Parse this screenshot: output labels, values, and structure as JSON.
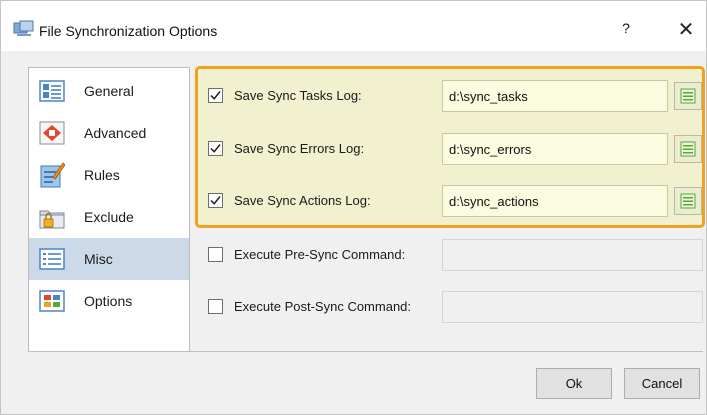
{
  "window": {
    "title": "File Synchronization Options",
    "help_label": "?",
    "close_label": "✕"
  },
  "nav": {
    "items": [
      {
        "label": "General",
        "icon": "general-icon",
        "selected": false
      },
      {
        "label": "Advanced",
        "icon": "advanced-icon",
        "selected": false
      },
      {
        "label": "Rules",
        "icon": "rules-icon",
        "selected": false
      },
      {
        "label": "Exclude",
        "icon": "exclude-icon",
        "selected": false
      },
      {
        "label": "Misc",
        "icon": "misc-icon",
        "selected": true
      },
      {
        "label": "Options",
        "icon": "options-icon",
        "selected": false
      }
    ]
  },
  "misc": {
    "tasks_log": {
      "label": "Save Sync Tasks Log:",
      "checked": true,
      "value": "d:\\sync_tasks"
    },
    "errors_log": {
      "label": "Save Sync Errors Log:",
      "checked": true,
      "value": "d:\\sync_errors"
    },
    "actions_log": {
      "label": "Save Sync Actions Log:",
      "checked": true,
      "value": "d:\\sync_actions"
    },
    "pre_sync": {
      "label": "Execute Pre-Sync Command:",
      "checked": false,
      "value": ""
    },
    "post_sync": {
      "label": "Execute Post-Sync Command:",
      "checked": false,
      "value": ""
    }
  },
  "buttons": {
    "ok": "Ok",
    "cancel": "Cancel"
  },
  "colors": {
    "highlight_border": "#f0a21e",
    "highlight_fill": "#f1f1cf",
    "selected_nav": "#ccd9e8"
  }
}
